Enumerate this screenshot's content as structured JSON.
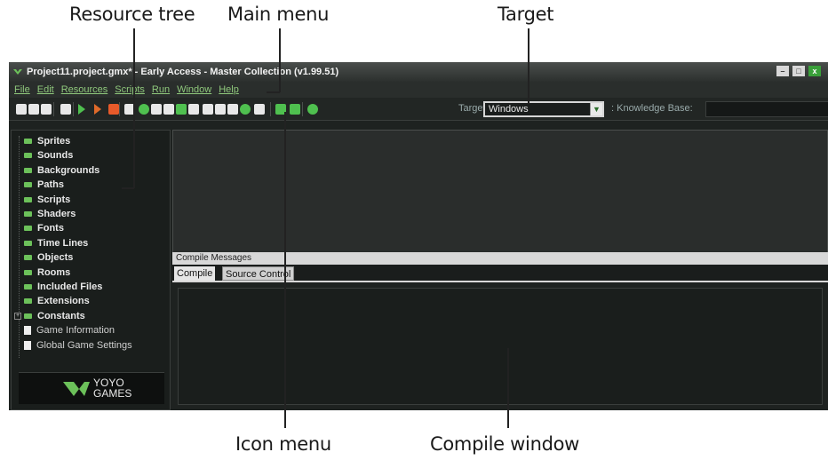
{
  "callouts": {
    "resource_tree": "Resource tree",
    "main_menu": "Main menu",
    "target": "Target",
    "icon_menu": "Icon menu",
    "compile_window": "Compile window"
  },
  "window": {
    "title": "Project11.project.gmx* - Early Access - Master Collection (v1.99.51)"
  },
  "menu": [
    "File",
    "Edit",
    "Resources",
    "Scripts",
    "Run",
    "Window",
    "Help"
  ],
  "toolbar": {
    "target_label": "Target",
    "target_value": "Windows",
    "kb_label": ": Knowledge Base:",
    "icons": [
      {
        "name": "new-project-icon",
        "color": "#e8e8e8"
      },
      {
        "name": "open-project-icon",
        "color": "#e8e8e8"
      },
      {
        "name": "save-project-icon",
        "color": "#e8e8e8"
      },
      {
        "name": "create-exe-icon",
        "color": "#e8e8e8"
      },
      {
        "name": "run-icon",
        "color": "#4fc04f"
      },
      {
        "name": "debug-icon",
        "color": "#e06a2a"
      },
      {
        "name": "clean-icon",
        "color": "#e85a2a"
      },
      {
        "name": "sprite-icon",
        "color": "#e8e8e8"
      },
      {
        "name": "sound-icon",
        "color": "#4fc04f"
      },
      {
        "name": "background-icon",
        "color": "#e8e8e8"
      },
      {
        "name": "path-icon",
        "color": "#e8e8e8"
      },
      {
        "name": "script-icon",
        "color": "#4fc04f"
      },
      {
        "name": "shader-icon",
        "color": "#e8e8e8"
      },
      {
        "name": "font-icon",
        "color": "#e8e8e8"
      },
      {
        "name": "timeline-icon",
        "color": "#e8e8e8"
      },
      {
        "name": "object-icon",
        "color": "#e8e8e8"
      },
      {
        "name": "room-icon",
        "color": "#4fc04f"
      },
      {
        "name": "game-info-icon",
        "color": "#e8e8e8"
      },
      {
        "name": "settings-icon",
        "color": "#4fc04f"
      },
      {
        "name": "extensions-icon",
        "color": "#4fc04f"
      },
      {
        "name": "help-icon",
        "color": "#4fc04f"
      }
    ]
  },
  "tree": {
    "items": [
      {
        "label": "Sprites",
        "type": "folder"
      },
      {
        "label": "Sounds",
        "type": "folder"
      },
      {
        "label": "Backgrounds",
        "type": "folder"
      },
      {
        "label": "Paths",
        "type": "folder"
      },
      {
        "label": "Scripts",
        "type": "folder"
      },
      {
        "label": "Shaders",
        "type": "folder"
      },
      {
        "label": "Fonts",
        "type": "folder"
      },
      {
        "label": "Time Lines",
        "type": "folder"
      },
      {
        "label": "Objects",
        "type": "folder"
      },
      {
        "label": "Rooms",
        "type": "folder"
      },
      {
        "label": "Included Files",
        "type": "folder"
      },
      {
        "label": "Extensions",
        "type": "folder"
      },
      {
        "label": "Constants",
        "type": "folder",
        "expandable": true
      },
      {
        "label": "Game Information",
        "type": "doc"
      },
      {
        "label": "Global Game Settings",
        "type": "doc"
      }
    ],
    "logo_line1": "YOYO",
    "logo_line2": "GAMES"
  },
  "compile": {
    "header": "Compile Messages",
    "tabs": [
      "Compile",
      "Source Control"
    ]
  },
  "colors": {
    "accent_green": "#6cc15a",
    "menu_green": "#8fc87c",
    "background_dark": "#1e2220"
  }
}
